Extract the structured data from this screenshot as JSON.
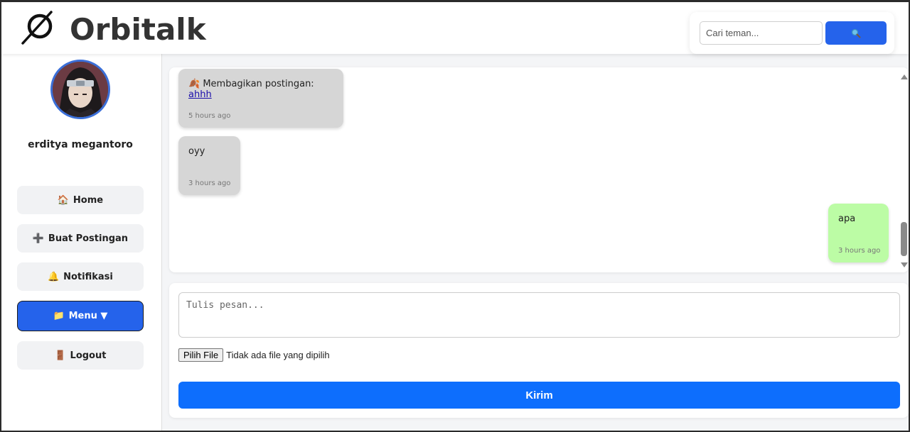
{
  "header": {
    "brand": "Orbitalk",
    "search_placeholder": "Cari teman...",
    "search_button_icon": "search-icon"
  },
  "sidebar": {
    "username": "erditya megantoro",
    "items": [
      {
        "icon": "🏠",
        "label": "Home"
      },
      {
        "icon": "➕",
        "label": "Buat Postingan"
      },
      {
        "icon": "🔔",
        "label": "Notifikasi"
      },
      {
        "icon": "📁",
        "label": "Menu ▼",
        "active": true
      },
      {
        "icon": "🚪",
        "label": "Logout"
      }
    ]
  },
  "chat": {
    "messages": [
      {
        "from": "other",
        "icon": "🍂",
        "prefix": "Membagikan postingan: ",
        "link": "ahhh",
        "time": "5 hours ago"
      },
      {
        "from": "other",
        "text": "oyy",
        "time": "3 hours ago"
      },
      {
        "from": "me",
        "text": "apa",
        "time": "3 hours ago"
      }
    ]
  },
  "compose": {
    "placeholder": "Tulis pesan...",
    "file_button": "Pilih File",
    "file_status": "Tidak ada file yang dipilih",
    "send_label": "Kirim"
  },
  "colors": {
    "accent": "#2563eb",
    "send": "#0d6efd",
    "bubble_other": "#d6d6d6",
    "bubble_mine": "#bcfca5"
  }
}
